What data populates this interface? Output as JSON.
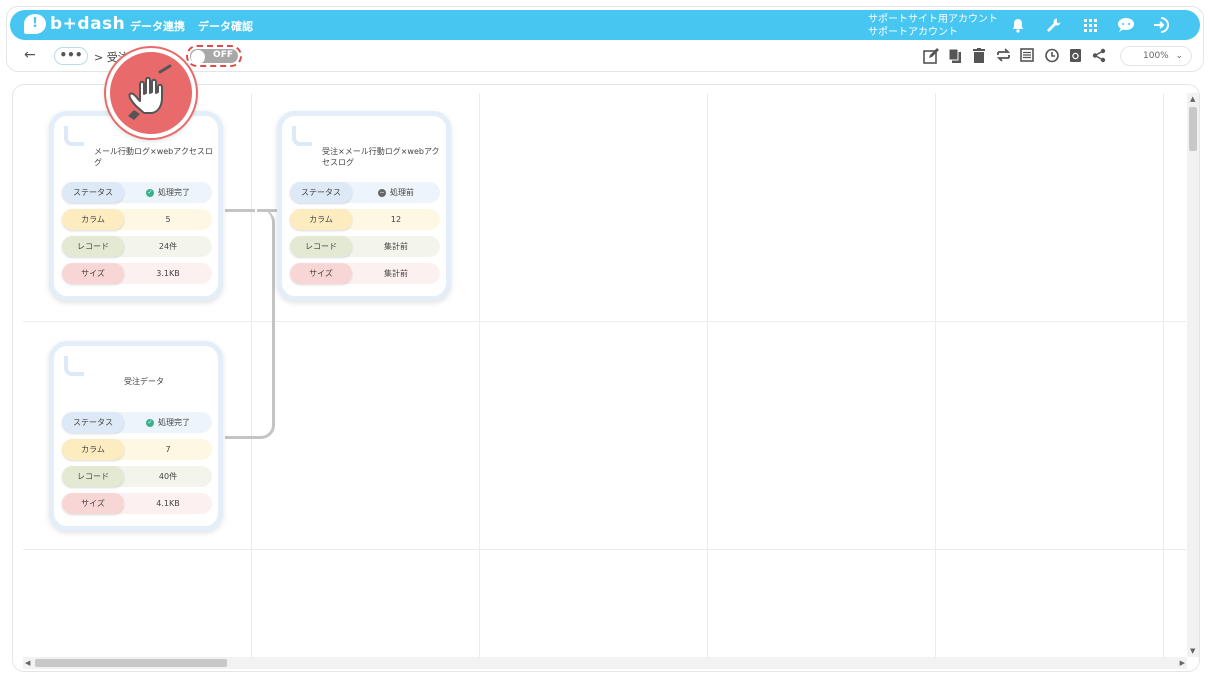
{
  "brand": {
    "logo_text": "b+dash"
  },
  "nav": {
    "link1": "データ連携",
    "link2": "データ確認"
  },
  "account": {
    "line1": "サポートサイト用アカウント",
    "line2": "サポートアカウント"
  },
  "header_icons": [
    "bell-icon",
    "wrench-icon",
    "apps-grid-icon",
    "chat-icon",
    "logout-icon"
  ],
  "subbar": {
    "back": "←",
    "more": "•••",
    "crumb": "> 受注",
    "toggle": "OFF",
    "zoom": "100%",
    "zoom_caret": "⌄"
  },
  "toolbar_icons": [
    "edit-icon",
    "copy-icon",
    "trash-icon",
    "swap-icon",
    "table-icon",
    "history-icon",
    "refresh-icon",
    "share-icon"
  ],
  "row_labels": {
    "status": "ステータス",
    "column": "カラム",
    "record": "レコード",
    "size": "サイズ"
  },
  "cards": [
    {
      "title": "メール行動ログ×webアクセスログ",
      "status": "処理完了",
      "columns": "5",
      "records": "24件",
      "size": "3.1KB"
    },
    {
      "title": "受注データ",
      "status": "処理完了",
      "columns": "7",
      "records": "40件",
      "size": "4.1KB"
    },
    {
      "title": "受注×メール行動ログ×webアクセスログ",
      "status": "処理前",
      "columns": "12",
      "records": "集計前",
      "size": "集計前"
    }
  ],
  "colors": {
    "accent": "#47c6f2",
    "done": "#38b08b",
    "highlight": "#e86a6a"
  }
}
